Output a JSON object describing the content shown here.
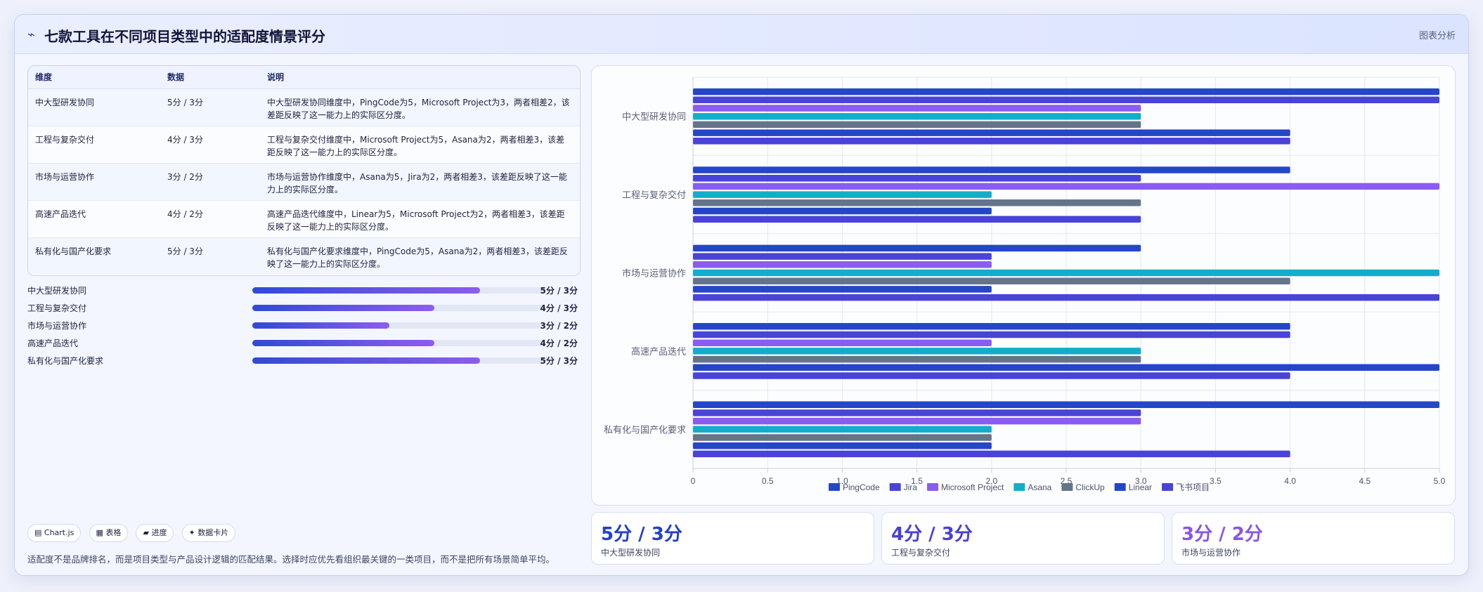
{
  "header": {
    "title": "七款工具在不同项目类型中的适配度情景评分",
    "action": "图表分析"
  },
  "table": {
    "headers": [
      "维度",
      "数据",
      "说明"
    ],
    "rows": [
      {
        "dim": "中大型研发协同",
        "data": "5分 / 3分",
        "desc": "中大型研发协同维度中，PingCode为5，Microsoft Project为3，两者相差2，该差距反映了这一能力上的实际区分度。"
      },
      {
        "dim": "工程与复杂交付",
        "data": "4分 / 3分",
        "desc": "工程与复杂交付维度中，Microsoft Project为5，Asana为2，两者相差3，该差距反映了这一能力上的实际区分度。"
      },
      {
        "dim": "市场与运营协作",
        "data": "3分 / 2分",
        "desc": "市场与运营协作维度中，Asana为5，Jira为2，两者相差3，该差距反映了这一能力上的实际区分度。"
      },
      {
        "dim": "高速产品迭代",
        "data": "4分 / 2分",
        "desc": "高速产品迭代维度中，Linear为5，Microsoft Project为2，两者相差3，该差距反映了这一能力上的实际区分度。"
      },
      {
        "dim": "私有化与国产化要求",
        "data": "5分 / 3分",
        "desc": "私有化与国产化要求维度中，PingCode为5，Asana为2，两者相差3，该差距反映了这一能力上的实际区分度。"
      }
    ]
  },
  "progress": [
    {
      "label": "中大型研发协同",
      "value": "5分 / 3分",
      "fraction": 0.78
    },
    {
      "label": "工程与复杂交付",
      "value": "4分 / 3分",
      "fraction": 0.625
    },
    {
      "label": "市场与运营协作",
      "value": "3分 / 2分",
      "fraction": 0.47
    },
    {
      "label": "高速产品迭代",
      "value": "4分 / 2分",
      "fraction": 0.625
    },
    {
      "label": "私有化与国产化要求",
      "value": "5分 / 3分",
      "fraction": 0.78
    }
  ],
  "tags": [
    "▤ Chart.js",
    "▦ 表格",
    "▰ 进度",
    "✦ 数据卡片"
  ],
  "footnote": "适配度不是品牌排名，而是项目类型与产品设计逻辑的匹配结果。选择时应优先看组织最关键的一类项目，而不是把所有场景简单平均。",
  "stats": [
    {
      "value": "5分 / 3分",
      "label": "中大型研发协同",
      "color": "#2340c8"
    },
    {
      "value": "4分 / 3分",
      "label": "工程与复杂交付",
      "color": "#4a3fd8"
    },
    {
      "value": "3分 / 2分",
      "label": "市场与运营协作",
      "color": "#8a55e8"
    }
  ],
  "chart_data": {
    "type": "bar",
    "orientation": "horizontal",
    "categories": [
      "中大型研发协同",
      "工程与复杂交付",
      "市场与运营协作",
      "高速产品迭代",
      "私有化与国产化要求"
    ],
    "series": [
      {
        "name": "PingCode",
        "color": "#2446c8",
        "values": [
          5,
          4,
          3,
          4,
          5
        ]
      },
      {
        "name": "Jira",
        "color": "#4a43d8",
        "values": [
          5,
          3,
          2,
          4,
          3
        ]
      },
      {
        "name": "Microsoft Project",
        "color": "#8b5cf0",
        "values": [
          3,
          5,
          2,
          2,
          3
        ]
      },
      {
        "name": "Asana",
        "color": "#12aec9",
        "values": [
          3,
          2,
          5,
          3,
          2
        ]
      },
      {
        "name": "ClickUp",
        "color": "#64748b",
        "values": [
          3,
          3,
          4,
          3,
          2
        ]
      },
      {
        "name": "Linear",
        "color": "#2446c8",
        "values": [
          4,
          2,
          2,
          5,
          2
        ]
      },
      {
        "name": "飞书项目",
        "color": "#4a43d8",
        "values": [
          4,
          3,
          5,
          4,
          4
        ]
      }
    ],
    "xlim": [
      0,
      5
    ],
    "xticks": [
      "0",
      "0.5",
      "1.0",
      "1.5",
      "2.0",
      "2.5",
      "3.0",
      "3.5",
      "4.0",
      "4.5",
      "5.0"
    ],
    "grid": true,
    "legend": "bottom"
  }
}
